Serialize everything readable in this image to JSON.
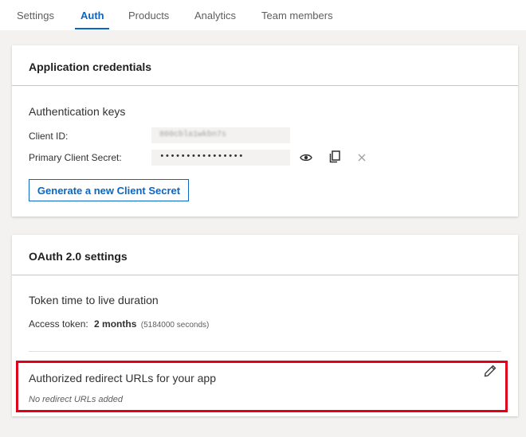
{
  "tabs": [
    {
      "label": "Settings",
      "active": false
    },
    {
      "label": "Auth",
      "active": true
    },
    {
      "label": "Products",
      "active": false
    },
    {
      "label": "Analytics",
      "active": false
    },
    {
      "label": "Team members",
      "active": false
    }
  ],
  "credentials_card": {
    "title": "Application credentials",
    "section_title": "Authentication keys",
    "client_id_label": "Client ID:",
    "client_id_value": "860cbla1wkbn7s",
    "secret_label": "Primary Client Secret:",
    "secret_value": "••••••••••••••••",
    "generate_button": "Generate a new Client Secret"
  },
  "oauth_card": {
    "title": "OAuth 2.0 settings",
    "ttl_title": "Token time to live duration",
    "access_token_label": "Access token:",
    "access_token_value": "2 months",
    "access_token_seconds": "(5184000 seconds)",
    "redirect_title": "Authorized redirect URLs for your app",
    "redirect_empty": "No redirect URLs added"
  },
  "icons": {
    "reveal": "eye-icon",
    "copy": "copy-icon",
    "clear": "close-icon",
    "edit": "pencil-icon"
  },
  "colors": {
    "accent": "#0a66c2",
    "highlight": "#e0001b"
  }
}
